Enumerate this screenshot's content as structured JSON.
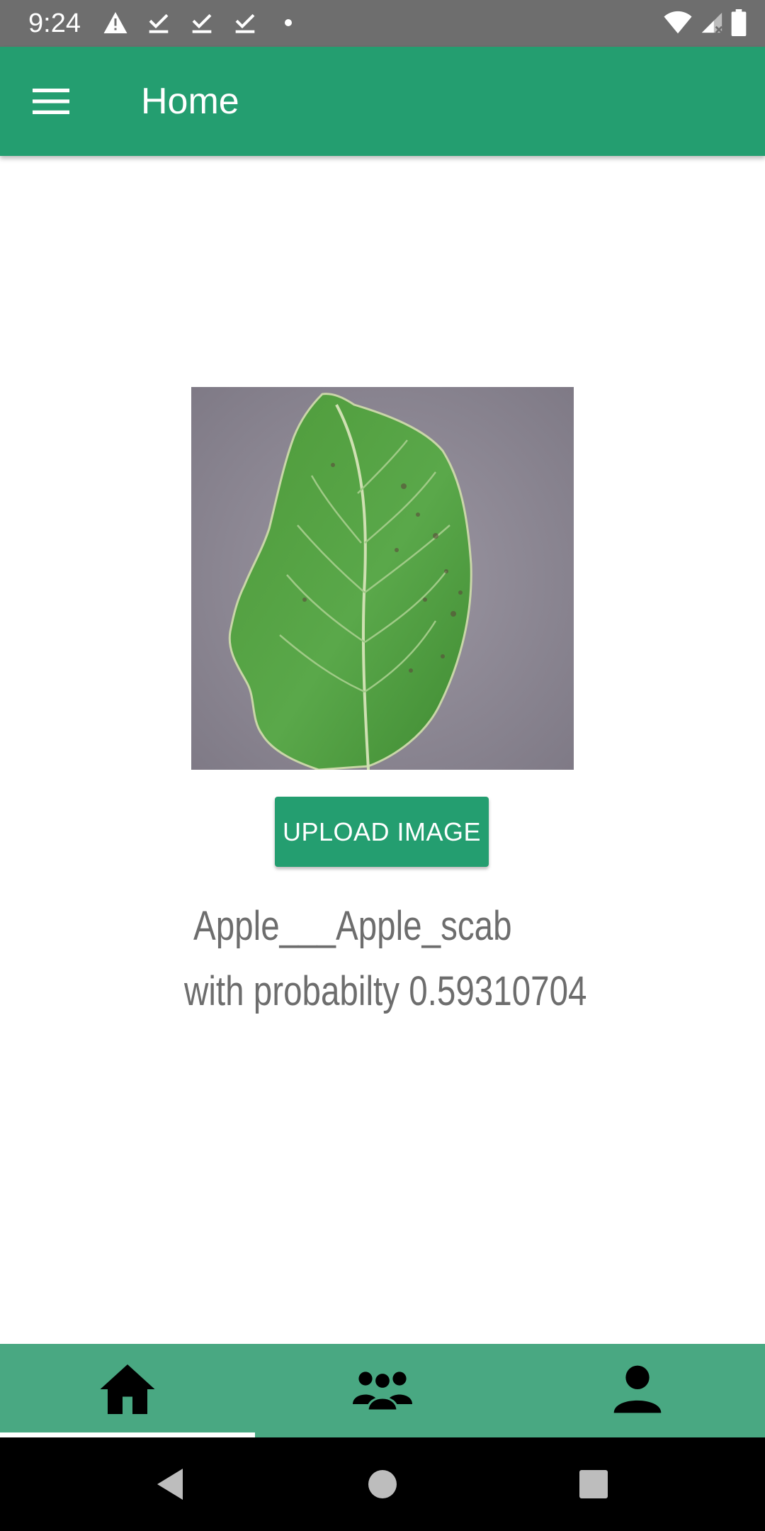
{
  "status_bar": {
    "time": "9:24",
    "left_icons": [
      "warning-icon",
      "check-download-icon",
      "check-download-icon",
      "check-download-icon",
      "dot-icon"
    ],
    "right_icons": [
      "wifi-icon",
      "signal-icon",
      "battery-icon"
    ]
  },
  "app_bar": {
    "title": "Home",
    "menu_icon": "hamburger-menu-icon",
    "color": "#249e70"
  },
  "main": {
    "image_subject": "leaf-image",
    "upload_button_label": "UPLOAD IMAGE",
    "result_label": "Apple___Apple_scab",
    "result_probability": "with probabilty 0.59310704"
  },
  "bottom_nav": {
    "color": "#49a882",
    "tabs": [
      {
        "icon": "home-icon",
        "selected": true
      },
      {
        "icon": "group-icon",
        "selected": false
      },
      {
        "icon": "person-icon",
        "selected": false
      }
    ]
  },
  "system_nav": {
    "buttons": [
      "back-icon",
      "home-circle-icon",
      "recents-icon"
    ]
  }
}
